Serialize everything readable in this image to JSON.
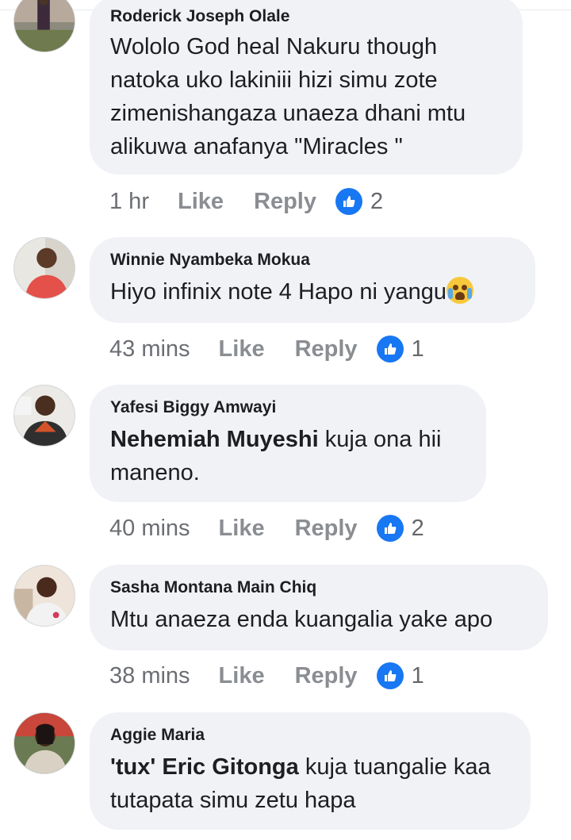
{
  "comments": [
    {
      "author": "Roderick Joseph Olale",
      "text": "Wololo God heal Nakuru though natoka uko lakiniii hizi simu zote zimenishangaza unaeza dhani mtu alikuwa anafanya \"Miracles \"",
      "time": "1 hr",
      "like_label": "Like",
      "reply_label": "Reply",
      "reactions": "2"
    },
    {
      "author": "Winnie Nyambeka Mokua",
      "text": "Hiyo infinix note 4 Hapo ni yangu",
      "emoji": "crying-face",
      "time": "43 mins",
      "like_label": "Like",
      "reply_label": "Reply",
      "reactions": "1"
    },
    {
      "author": "Yafesi Biggy Amwayi",
      "mention": "Nehemiah Muyeshi",
      "text": " kuja ona hii maneno.",
      "time": "40 mins",
      "like_label": "Like",
      "reply_label": "Reply",
      "reactions": "2"
    },
    {
      "author": "Sasha Montana Main Chiq",
      "text": "Mtu anaeza enda kuangalia yake apo",
      "time": "38 mins",
      "like_label": "Like",
      "reply_label": "Reply",
      "reactions": "1"
    },
    {
      "author": "Aggie Maria",
      "mention": "'tux' Eric Gitonga",
      "text": " kuja tuangalie kaa tutapata simu zetu hapa"
    }
  ],
  "colors": {
    "bubble": "#f0f2f5",
    "like_blue": "#1877f2",
    "meta_gray": "#65676b"
  }
}
